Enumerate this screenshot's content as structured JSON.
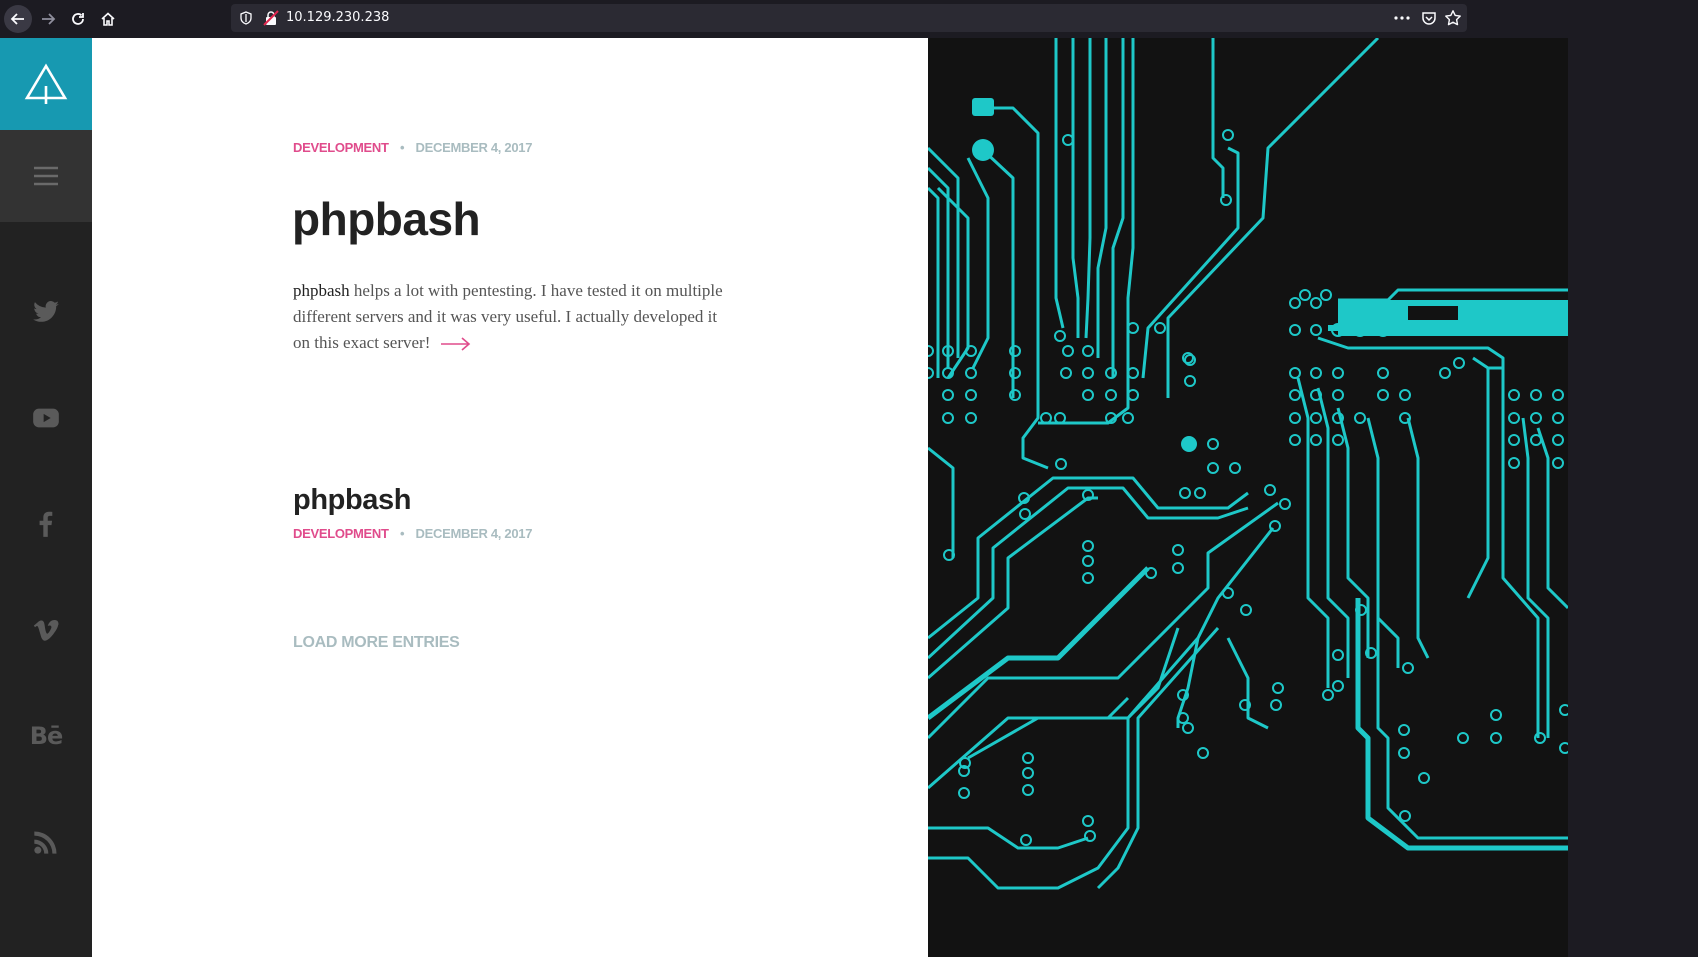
{
  "browser": {
    "url": "10.129.230.238",
    "icons": [
      "back-arrow-icon",
      "forward-arrow-icon",
      "reload-icon",
      "home-icon",
      "shield-icon",
      "insecure-lock-icon",
      "more-icon",
      "pocket-icon",
      "star-icon"
    ]
  },
  "sidebar": {
    "logo_icon": "tree-logo-icon",
    "menu_icon": "hamburger-menu-icon",
    "social": [
      "twitter-icon",
      "youtube-icon",
      "facebook-icon",
      "vimeo-icon",
      "behance-icon",
      "rss-icon"
    ],
    "behance_label": "Bē"
  },
  "posts": {
    "featured": {
      "category": "DEVELOPMENT",
      "separator": "•",
      "date": "DECEMBER 4, 2017",
      "title": "phpbash",
      "excerpt_lead": "phpbash",
      "excerpt_rest": " helps a lot with pentesting. I have tested it on multiple different servers and it was very useful. I actually developed it on this exact server!"
    },
    "second": {
      "title": "phpbash",
      "category": "DEVELOPMENT",
      "separator": "•",
      "date": "DECEMBER 4, 2017"
    },
    "load_more": "LOAD MORE ENTRIES"
  },
  "colors": {
    "accent_teal": "#1799b1",
    "category_pink": "#e04c8c",
    "circuit_cyan": "#1ec8c8"
  }
}
